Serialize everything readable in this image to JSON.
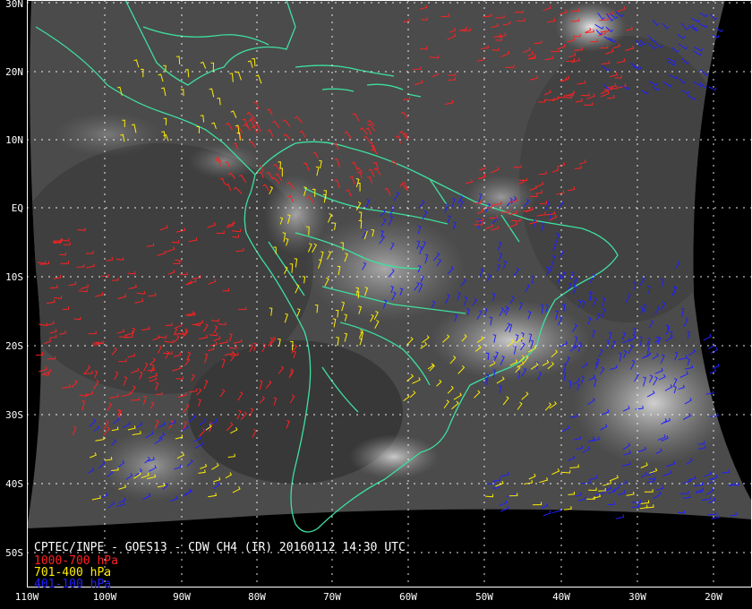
{
  "lat_labels": [
    "30N",
    "20N",
    "10N",
    "EQ",
    "10S",
    "20S",
    "30S",
    "40S",
    "50S"
  ],
  "lon_labels": [
    "110W",
    "100W",
    "90W",
    "80W",
    "70W",
    "60W",
    "50W",
    "40W",
    "30W",
    "20W"
  ],
  "caption": "CPTEC/INPE - GOES13 - CDW CH4 (IR) 20160112 14:30 UTC",
  "legend": [
    {
      "label": "1000-700 hPa",
      "color": "#ff2020"
    },
    {
      "label": "701-400 hPa",
      "color": "#ffee00"
    },
    {
      "label": "401-100 hPa",
      "color": "#2020ff"
    }
  ],
  "colors": {
    "coastline": "#3ee0a0",
    "grid": "#ffffff",
    "background": "#000000"
  }
}
